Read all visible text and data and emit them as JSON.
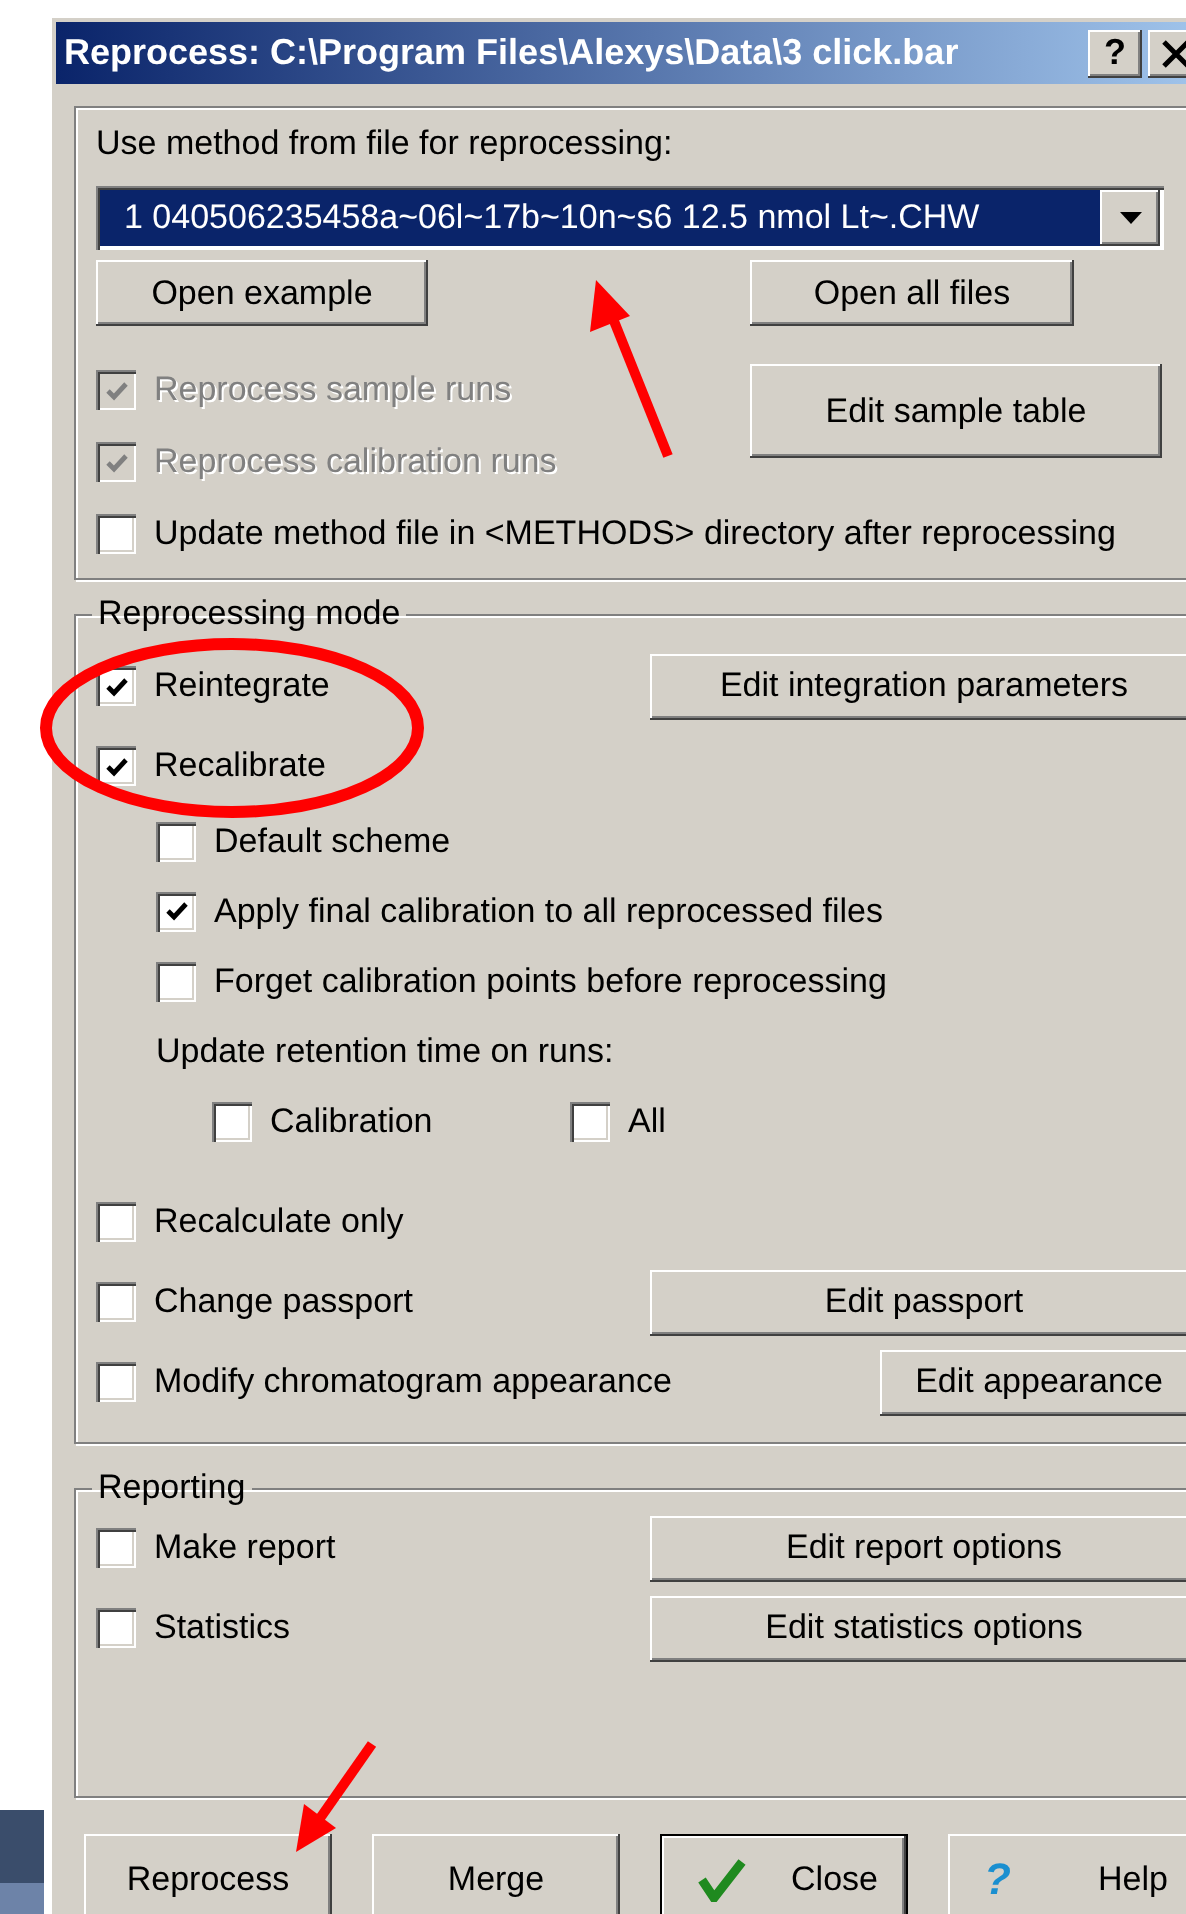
{
  "window": {
    "title": "Reprocess: C:\\Program Files\\Alexys\\Data\\3 click.bar",
    "help_button": "?"
  },
  "method_group": {
    "label": "Use method from file for reprocessing:",
    "file_dropdown": {
      "value": "1  040506235458a~06l~17b~10n~s6 12.5 nmol Lt~.CHW"
    },
    "buttons": [
      "Open example",
      "Open all files",
      "Edit sample table"
    ],
    "options": [
      {
        "label": "Reprocess sample runs",
        "checked": true,
        "disabled": true
      },
      {
        "label": "Reprocess calibration runs",
        "checked": true,
        "disabled": true
      },
      {
        "label": "Update method file in <METHODS> directory after reprocessing",
        "checked": false,
        "disabled": false
      }
    ]
  },
  "mode_group": {
    "title": "Reprocessing mode",
    "items": [
      {
        "kind": "check",
        "label": "Reintegrate",
        "checked": true,
        "button": {
          "label": "Edit integration parameters"
        }
      },
      {
        "kind": "check",
        "label": "Recalibrate",
        "checked": true
      },
      {
        "kind": "sub_check",
        "label": "Default scheme",
        "checked": false
      },
      {
        "kind": "sub_check",
        "label": "Apply final calibration to all reprocessed files",
        "checked": true
      },
      {
        "kind": "sub_check",
        "label": "Forget calibration points before reprocessing",
        "checked": false
      },
      {
        "kind": "note",
        "text": "Update retention time on runs:"
      },
      {
        "kind": "check_pair",
        "options": [
          {
            "label": "Calibration",
            "checked": false
          },
          {
            "label": "All",
            "checked": false
          }
        ]
      },
      {
        "kind": "check",
        "label": "Recalculate only",
        "checked": false
      },
      {
        "kind": "check",
        "label": "Change passport",
        "checked": false,
        "button": {
          "label": "Edit passport"
        }
      },
      {
        "kind": "check",
        "label": "Modify chromatogram appearance",
        "checked": false,
        "button": {
          "label": "Edit appearance"
        }
      }
    ]
  },
  "reporting_group": {
    "title": "Reporting",
    "items": [
      {
        "kind": "check",
        "label": "Make report",
        "checked": false,
        "button": {
          "label": "Edit report options"
        }
      },
      {
        "kind": "check",
        "label": "Statistics",
        "checked": false,
        "button": {
          "label": "Edit statistics options"
        }
      }
    ]
  },
  "footer_buttons": [
    {
      "label": "Reprocess",
      "default": false
    },
    {
      "label": "Merge",
      "default": false
    },
    {
      "label": "Close",
      "default": true
    },
    {
      "label": "Help",
      "default": false,
      "glyph": "?"
    }
  ]
}
